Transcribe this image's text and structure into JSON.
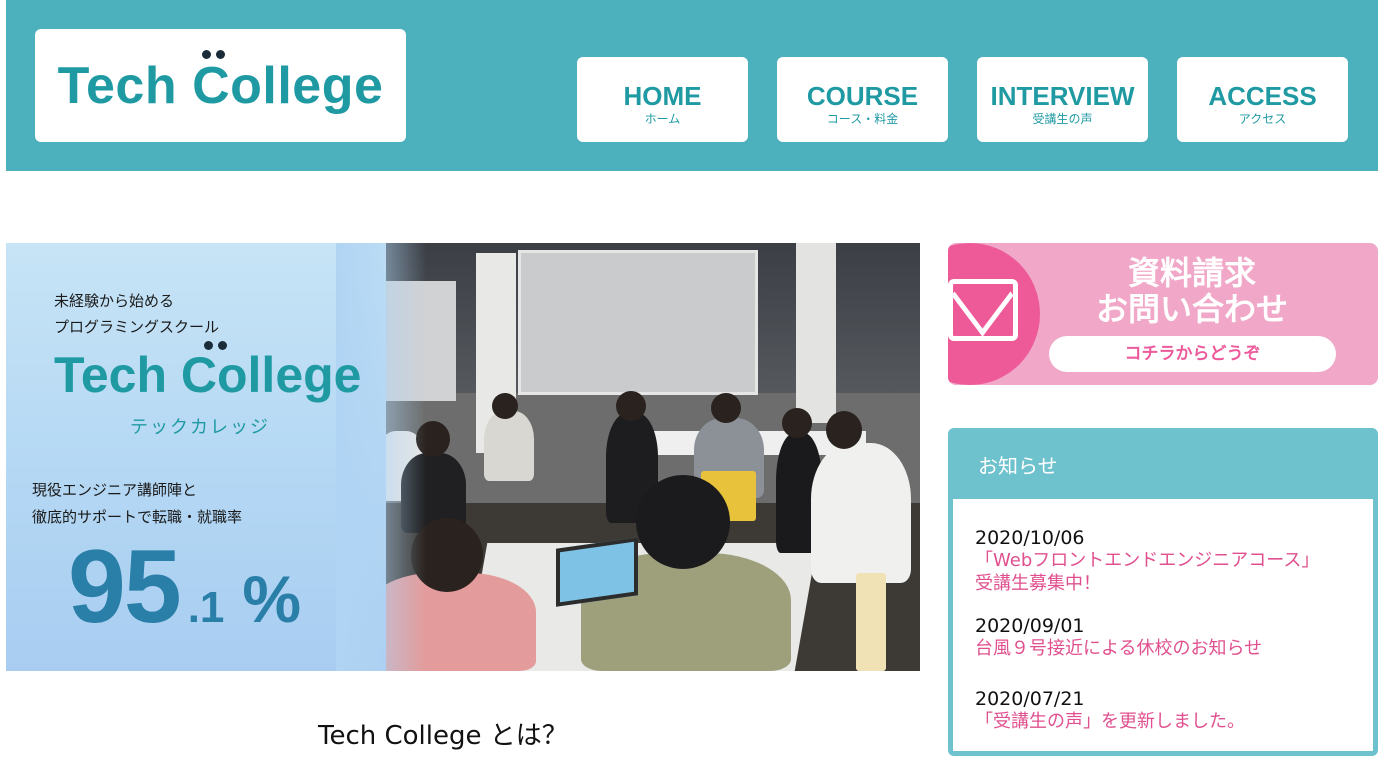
{
  "header": {
    "logo_text": "Tech College",
    "nav": [
      {
        "en": "HOME",
        "ja": "ホーム"
      },
      {
        "en": "COURSE",
        "ja": "コース・料金"
      },
      {
        "en": "INTERVIEW",
        "ja": "受講生の声"
      },
      {
        "en": "ACCESS",
        "ja": "アクセス"
      }
    ]
  },
  "hero": {
    "tagline_line1": "未経験から始める",
    "tagline_line2": "プログラミングスクール",
    "logo_text": "Tech College",
    "logo_kana": "テックカレッジ",
    "support_line1": "現役エンジニア講師陣と",
    "support_line2": "徹底的サポートで転職・就職率",
    "rate_integer": "95",
    "rate_decimal": ".1",
    "rate_unit": "%"
  },
  "about": {
    "heading": "Tech College とは？"
  },
  "cta": {
    "title_line1": "資料請求",
    "title_line2": "お問い合わせ",
    "button_label": "コチラからどうぞ",
    "icon": "envelope-icon"
  },
  "news": {
    "heading": "お知らせ",
    "items": [
      {
        "date": "2020/10/06",
        "title_line1": "「Webフロントエンドエンジニアコース」",
        "title_line2": "受講生募集中！"
      },
      {
        "date": "2020/09/01",
        "title_line1": "台風９号接近による休校のお知らせ",
        "title_line2": ""
      },
      {
        "date": "2020/07/21",
        "title_line1": "「受講生の声」を更新しました。",
        "title_line2": ""
      }
    ]
  },
  "colors": {
    "header_bg": "#4cb0bd",
    "brand_teal": "#1f9aa3",
    "cta_pink": "#f1a8c8",
    "cta_magenta": "#ee5a98",
    "news_link": "#e0508f"
  }
}
